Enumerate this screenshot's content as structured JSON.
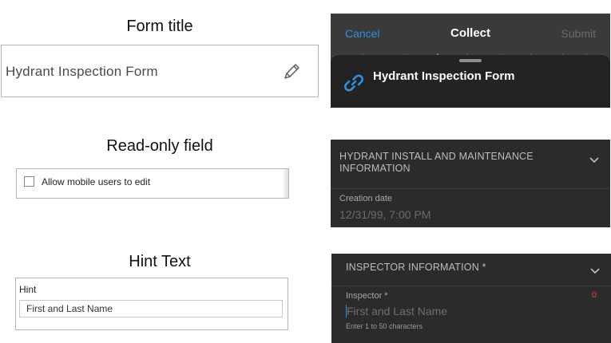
{
  "left": {
    "form_title_heading": "Form title",
    "form_title_value": "Hydrant Inspection Form",
    "readonly_heading": "Read-only field",
    "readonly_checkbox_label": "Allow mobile users to edit",
    "hint_heading": "Hint Text",
    "hint_label": "Hint",
    "hint_value": "First and Last Name"
  },
  "right": {
    "navbar": {
      "cancel": "Cancel",
      "title": "Collect",
      "submit": "Submit"
    },
    "sheet_title": "Hydrant Inspection Form",
    "section1": {
      "title": "HYDRANT INSTALL AND MAINTENANCE INFORMATION",
      "field_label": "Creation date",
      "field_value": "12/31/99, 7:00 PM"
    },
    "section2": {
      "title": "INSPECTOR INFORMATION *",
      "field_label": "Inspector *",
      "char_count": "0",
      "placeholder": "First and Last Name",
      "hint": "Enter 1 to 50 characters"
    }
  },
  "colors": {
    "accent_blue": "#2f8fe0",
    "dark_panel": "#2b2b2b",
    "required_red": "#e0473a"
  },
  "icons": [
    "pencil-icon",
    "link-icon",
    "chevron-down-icon",
    "checkbox"
  ]
}
